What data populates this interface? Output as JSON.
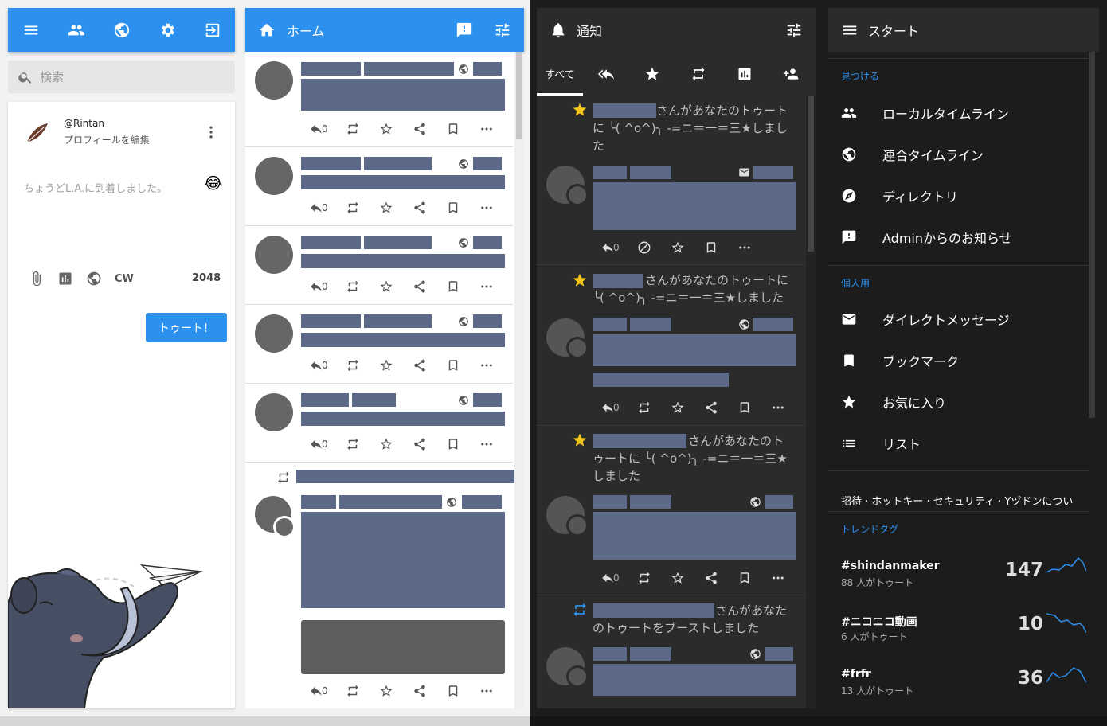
{
  "nav": {
    "icons": [
      "menu-icon",
      "people-icon",
      "globe-icon",
      "gear-icon",
      "logout-icon"
    ]
  },
  "search": {
    "placeholder": "検索"
  },
  "compose": {
    "handle": "@Rintan",
    "edit_profile": "プロフィールを編集",
    "placeholder": "ちょうどL.A.に到着しました。",
    "emoji": "😂",
    "cw": "CW",
    "counter": "2048",
    "toot_label": "トゥート！"
  },
  "home": {
    "title": "ホーム",
    "statuses": [
      {
        "replies": "0"
      },
      {
        "replies": "0"
      },
      {
        "replies": "0"
      },
      {
        "replies": "0"
      },
      {
        "replies": "0"
      },
      {
        "replies": "0"
      }
    ]
  },
  "notifications": {
    "title": "通知",
    "tab_all": "すべて",
    "items": [
      {
        "text": "さんがあなたのトゥートに ╰( ^o^)╮ -=ニ＝一＝三★しました",
        "replies": "0"
      },
      {
        "text": "さんがあなたのトゥートに ╰( ^o^)╮ -=ニ＝一＝三★しました",
        "replies": "0"
      },
      {
        "text": "さんがあなたのトゥートに ╰( ^o^)╮ -=ニ＝一＝三★しました",
        "replies": "0"
      },
      {
        "text": "さんがあなたのトゥートをブーストしました"
      }
    ]
  },
  "start": {
    "title": "スタート",
    "discover_heading": "見つける",
    "discover_items": [
      "ローカルタイムライン",
      "連合タイムライン",
      "ディレクトリ",
      "Adminからのお知らせ"
    ],
    "personal_heading": "個人用",
    "personal_items": [
      "ダイレクトメッセージ",
      "ブックマーク",
      "お気に入り",
      "リスト"
    ],
    "footer_links": "招待 · ホットキー · セキュリティ · Yヅドンについ",
    "trends_heading": "トレンドタグ",
    "trends": [
      {
        "tag": "#shindanmaker",
        "people": "88 人がトゥート",
        "count": "147"
      },
      {
        "tag": "#ニコニコ動画",
        "people": "6 人がトゥート",
        "count": "10"
      },
      {
        "tag": "#frfr",
        "people": "13 人がトゥート",
        "count": "36"
      }
    ]
  },
  "colors": {
    "accent": "#2b90ee",
    "favourite": "#f5c518",
    "redacted": "#5d6988"
  }
}
